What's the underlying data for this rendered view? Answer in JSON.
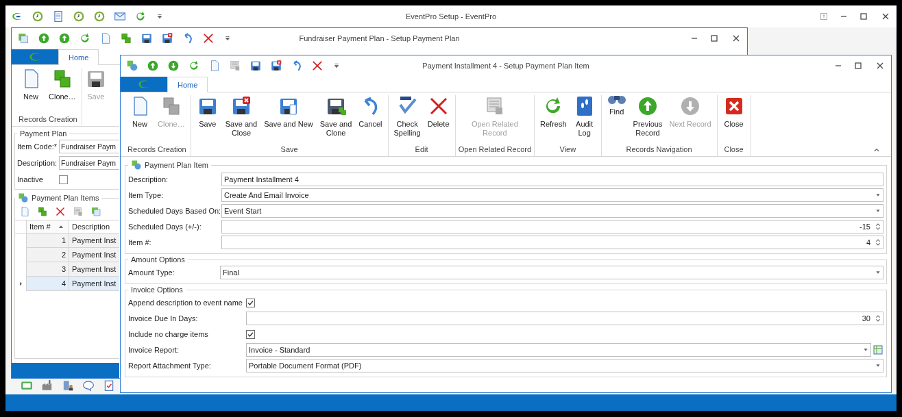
{
  "main_window": {
    "title": "EventPro Setup - EventPro"
  },
  "back_window": {
    "title": "Fundraiser Payment Plan - Setup Payment Plan",
    "tabs": [
      {
        "label": "Home",
        "selected": true
      }
    ],
    "ribbon": {
      "buttons": [
        {
          "label": "New",
          "kind": "new",
          "disabled": false
        },
        {
          "label": "Clone…",
          "kind": "clone",
          "disabled": false
        },
        {
          "label": "Save",
          "kind": "save",
          "disabled": true
        }
      ],
      "group": "Records Creation"
    },
    "payment_plan": {
      "title": "Payment Plan",
      "fields": [
        {
          "label": "Item Code:*",
          "value": "Fundraiser Paym"
        },
        {
          "label": "Description:",
          "value": "Fundraiser Paym"
        }
      ],
      "inactive": {
        "label": "Inactive",
        "checked": false
      }
    },
    "items": {
      "title": "Payment Plan Items",
      "columns": [
        {
          "label": "Item #",
          "sorted": true
        },
        {
          "label": "Description",
          "sorted": false
        }
      ],
      "rows": [
        {
          "item": "1",
          "description": "Payment Inst",
          "selected": false
        },
        {
          "item": "2",
          "description": "Payment Inst",
          "selected": false
        },
        {
          "item": "3",
          "description": "Payment Inst",
          "selected": false
        },
        {
          "item": "4",
          "description": "Payment Inst",
          "selected": true
        }
      ]
    }
  },
  "front_window": {
    "title": "Payment Installment 4 - Setup Payment Plan Item",
    "tabs": [
      {
        "label": "Home",
        "selected": true
      }
    ],
    "ribbon": [
      {
        "label": "Records Creation",
        "buttons": [
          {
            "label": "New",
            "kind": "new",
            "disabled": false
          },
          {
            "label": "Clone…",
            "kind": "clone",
            "disabled": true
          }
        ]
      },
      {
        "label": "Save",
        "buttons": [
          {
            "label": "Save",
            "kind": "save",
            "disabled": false
          },
          {
            "label": "Save and\nClose",
            "kind": "save-close",
            "disabled": false
          },
          {
            "label": "Save and New",
            "kind": "save-new",
            "disabled": false
          },
          {
            "label": "Save and\nClone",
            "kind": "save-clone",
            "disabled": false
          },
          {
            "label": "Cancel",
            "kind": "undo",
            "disabled": false
          }
        ]
      },
      {
        "label": "Edit",
        "buttons": [
          {
            "label": "Check\nSpelling",
            "kind": "spelling",
            "disabled": false
          },
          {
            "label": "Delete",
            "kind": "delete",
            "disabled": false
          }
        ]
      },
      {
        "label": "Open Related Record",
        "buttons": [
          {
            "label": "Open Related\nRecord",
            "kind": "related",
            "disabled": true
          }
        ]
      },
      {
        "label": "View",
        "buttons": [
          {
            "label": "Refresh",
            "kind": "refresh",
            "disabled": false
          },
          {
            "label": "Audit\nLog",
            "kind": "audit",
            "disabled": false
          }
        ]
      },
      {
        "label": "Records Navigation",
        "buttons": [
          {
            "label": "Find",
            "kind": "find",
            "disabled": false
          },
          {
            "label": "Previous\nRecord",
            "kind": "up",
            "disabled": false
          },
          {
            "label": "Next Record",
            "kind": "down",
            "disabled": true
          }
        ]
      },
      {
        "label": "Close",
        "buttons": [
          {
            "label": "Close",
            "kind": "close",
            "disabled": false
          }
        ]
      }
    ],
    "sections": [
      {
        "title": "Payment Plan Item",
        "kind": "icon",
        "fields": [
          {
            "label": "Description:",
            "kind": "text",
            "value": "Payment Installment 4"
          },
          {
            "label": "Item Type:",
            "kind": "combo",
            "value": "Create And Email Invoice"
          },
          {
            "label": "Scheduled Days Based On:",
            "kind": "combo",
            "value": "Event Start"
          },
          {
            "label": "Scheduled Days (+/-):",
            "kind": "spin",
            "value": "-15"
          },
          {
            "label": "Item #:",
            "kind": "spin",
            "value": "4"
          }
        ]
      },
      {
        "title": "Amount Options",
        "kind": "plain",
        "fields": [
          {
            "label": "Amount Type:",
            "kind": "combo",
            "value": "Final"
          }
        ]
      },
      {
        "title": "Invoice Options",
        "kind": "plain",
        "fields": [
          {
            "label": "Append description to event name",
            "kind": "check",
            "checked": true
          },
          {
            "label": "Invoice Due In Days:",
            "kind": "spin",
            "value": "30"
          },
          {
            "label": "Include no charge items",
            "kind": "check",
            "checked": true
          },
          {
            "label": "Invoice Report:",
            "kind": "lookup",
            "value": "Invoice - Standard"
          },
          {
            "label": "Report Attachment Type:",
            "kind": "combo",
            "value": "Portable Document Format (PDF)"
          }
        ]
      }
    ]
  }
}
